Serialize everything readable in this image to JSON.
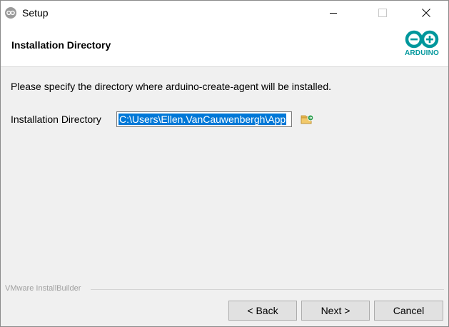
{
  "window": {
    "title": "Setup"
  },
  "header": {
    "title": "Installation Directory",
    "logo_text": "ARDUINO"
  },
  "body": {
    "instruction": "Please specify the directory where arduino-create-agent will be installed.",
    "directory_label": "Installation Directory",
    "directory_value": "C:\\Users\\Ellen.VanCauwenbergh\\App"
  },
  "footer": {
    "brand": "VMware InstallBuilder",
    "back_label": "< Back",
    "next_label": "Next >",
    "cancel_label": "Cancel"
  },
  "colors": {
    "accent_teal": "#00979c",
    "selection_blue": "#0078d7"
  },
  "icons": {
    "app": "arduino-app-icon",
    "browse": "folder-browse-icon",
    "close": "close-icon"
  }
}
